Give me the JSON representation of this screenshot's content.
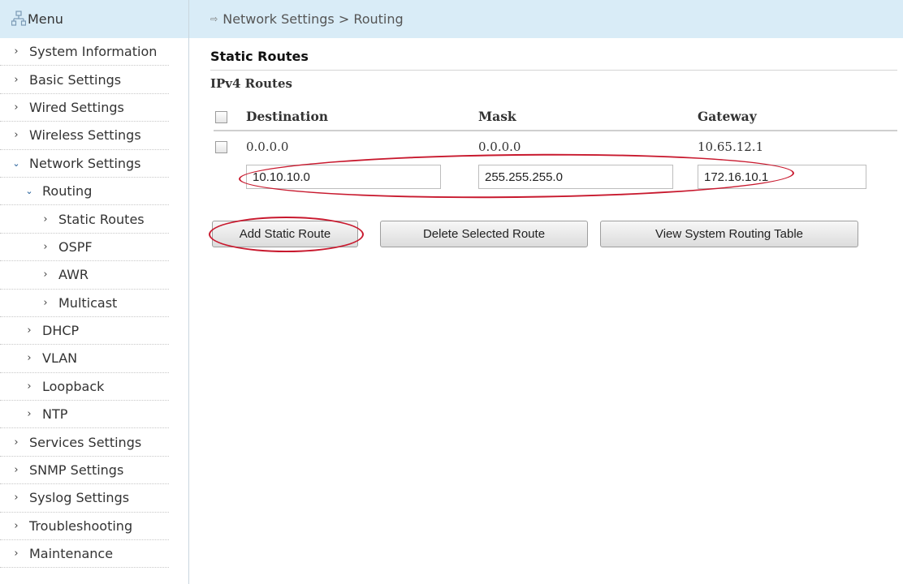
{
  "sidebar": {
    "title": "Menu",
    "items": [
      {
        "label": "System Information"
      },
      {
        "label": "Basic Settings"
      },
      {
        "label": "Wired Settings"
      },
      {
        "label": "Wireless Settings"
      },
      {
        "label": "Network Settings"
      },
      {
        "label": "Routing"
      },
      {
        "label": "Static Routes"
      },
      {
        "label": "OSPF"
      },
      {
        "label": "AWR"
      },
      {
        "label": "Multicast"
      },
      {
        "label": "DHCP"
      },
      {
        "label": "VLAN"
      },
      {
        "label": "Loopback"
      },
      {
        "label": "NTP"
      },
      {
        "label": "Services Settings"
      },
      {
        "label": "SNMP Settings"
      },
      {
        "label": "Syslog Settings"
      },
      {
        "label": "Troubleshooting"
      },
      {
        "label": "Maintenance"
      }
    ]
  },
  "breadcrumb": "Network Settings > Routing",
  "section_title": "Static Routes",
  "subsection_title": "IPv4 Routes",
  "table": {
    "headers": [
      "Destination",
      "Mask",
      "Gateway"
    ],
    "rows": [
      {
        "destination": "0.0.0.0",
        "mask": "0.0.0.0",
        "gateway": "10.65.12.1"
      }
    ]
  },
  "new_route": {
    "destination": "10.10.10.0",
    "mask": "255.255.255.0",
    "gateway": "172.16.10.1"
  },
  "buttons": {
    "add": "Add Static Route",
    "delete": "Delete Selected Route",
    "view": "View System Routing Table"
  },
  "colors": {
    "header_bg": "#d9ecf7",
    "annotation": "#c8192e"
  }
}
